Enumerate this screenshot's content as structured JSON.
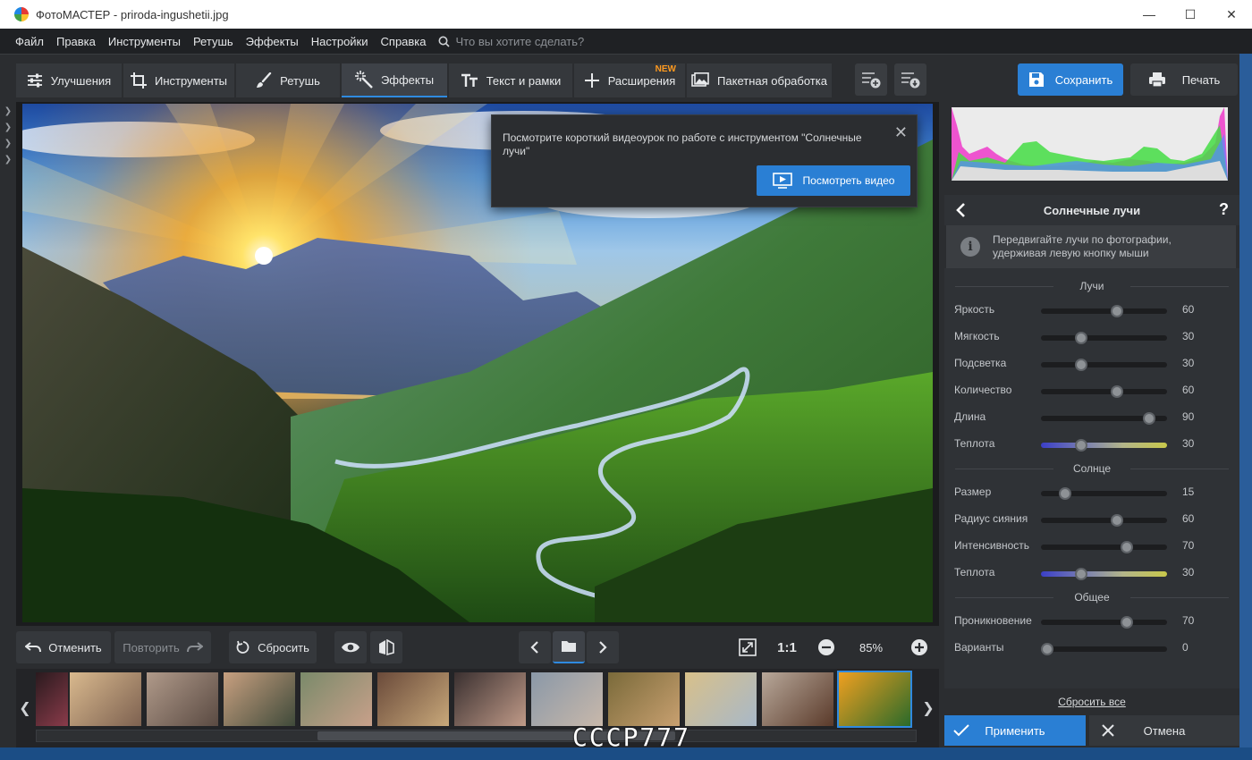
{
  "window": {
    "title": "ФотоМАСТЕР - priroda-ingushetii.jpg",
    "minimize": "—",
    "maximize": "☐",
    "close": "✕"
  },
  "menu": {
    "items": [
      "Файл",
      "Правка",
      "Инструменты",
      "Ретушь",
      "Эффекты",
      "Настройки",
      "Справка"
    ],
    "search_placeholder": "Что вы хотите сделать?"
  },
  "tabs": [
    {
      "label": "Улучшения",
      "icon": "sliders-icon"
    },
    {
      "label": "Инструменты",
      "icon": "crop-icon"
    },
    {
      "label": "Ретушь",
      "icon": "brush-icon"
    },
    {
      "label": "Эффекты",
      "icon": "magic-wand-icon",
      "active": true
    },
    {
      "label": "Текст и рамки",
      "icon": "text-icon"
    },
    {
      "label": "Расширения",
      "icon": "plus-icon",
      "badge": "NEW"
    },
    {
      "label": "Пакетная обработка",
      "icon": "images-icon"
    }
  ],
  "toolbar": {
    "save_label": "Сохранить",
    "print_label": "Печать"
  },
  "tip": {
    "text": "Посмотрите короткий видеоурок по работе с инструментом \"Солнечные лучи\"",
    "close": "✕",
    "video_label": "Посмотреть видео"
  },
  "controls": {
    "undo_label": "Отменить",
    "redo_label": "Повторить",
    "reset_label": "Сбросить",
    "ratio_label": "1:1",
    "zoom": "85%"
  },
  "filmstrip": {
    "prev": "❮",
    "next": "❯",
    "thumbs": [
      {
        "colors": [
          "#2a1a1e",
          "#8a3b4a"
        ]
      },
      {
        "colors": [
          "#d9b98e",
          "#7d6150"
        ]
      },
      {
        "colors": [
          "#b09a8a",
          "#5a4a42"
        ]
      },
      {
        "colors": [
          "#c8a080",
          "#3f4a3a"
        ]
      },
      {
        "colors": [
          "#7a8a6a",
          "#c8a08a"
        ]
      },
      {
        "colors": [
          "#6a4a3a",
          "#c8a87a"
        ]
      },
      {
        "colors": [
          "#3a3030",
          "#c09a88"
        ]
      },
      {
        "colors": [
          "#8a98a8",
          "#c8b8aa"
        ]
      },
      {
        "colors": [
          "#7a6a3a",
          "#c8a070"
        ]
      },
      {
        "colors": [
          "#d8c08a",
          "#a8b8c8"
        ]
      },
      {
        "colors": [
          "#b8a89a",
          "#5a3a2a"
        ]
      },
      {
        "colors": [
          "#f0a020",
          "#2a6a2a"
        ],
        "active": true
      }
    ]
  },
  "watermark": "СССР777",
  "panel": {
    "title": "Солнечные лучи",
    "help": "?",
    "hint": "Передвигайте лучи по фотографии, удерживая левую кнопку мыши",
    "hint_icon": "i",
    "sections": [
      {
        "title": "Лучи",
        "sliders": [
          {
            "label": "Яркость",
            "value": 60,
            "fraction": 0.6
          },
          {
            "label": "Мягкость",
            "value": 30,
            "fraction": 0.32
          },
          {
            "label": "Подсветка",
            "value": 30,
            "fraction": 0.32
          },
          {
            "label": "Количество",
            "value": 60,
            "fraction": 0.6
          },
          {
            "label": "Длина",
            "value": 90,
            "fraction": 0.86
          },
          {
            "label": "Теплота",
            "value": 30,
            "fraction": 0.32,
            "warm": true
          }
        ]
      },
      {
        "title": "Солнце",
        "sliders": [
          {
            "label": "Размер",
            "value": 15,
            "fraction": 0.19
          },
          {
            "label": "Радиус сияния",
            "value": 60,
            "fraction": 0.6
          },
          {
            "label": "Интенсивность",
            "value": 70,
            "fraction": 0.68
          },
          {
            "label": "Теплота",
            "value": 30,
            "fraction": 0.32,
            "warm": true
          }
        ]
      },
      {
        "title": "Общее",
        "sliders": [
          {
            "label": "Проникновение",
            "value": 70,
            "fraction": 0.68
          },
          {
            "label": "Варианты",
            "value": 0,
            "fraction": 0.05
          }
        ]
      }
    ],
    "reset_all": "Сбросить все",
    "apply_label": "Применить",
    "cancel_label": "Отмена"
  },
  "colors": {
    "accent": "#2a7fd4",
    "badge": "#ff9a1f",
    "background": "#2b2d30"
  }
}
